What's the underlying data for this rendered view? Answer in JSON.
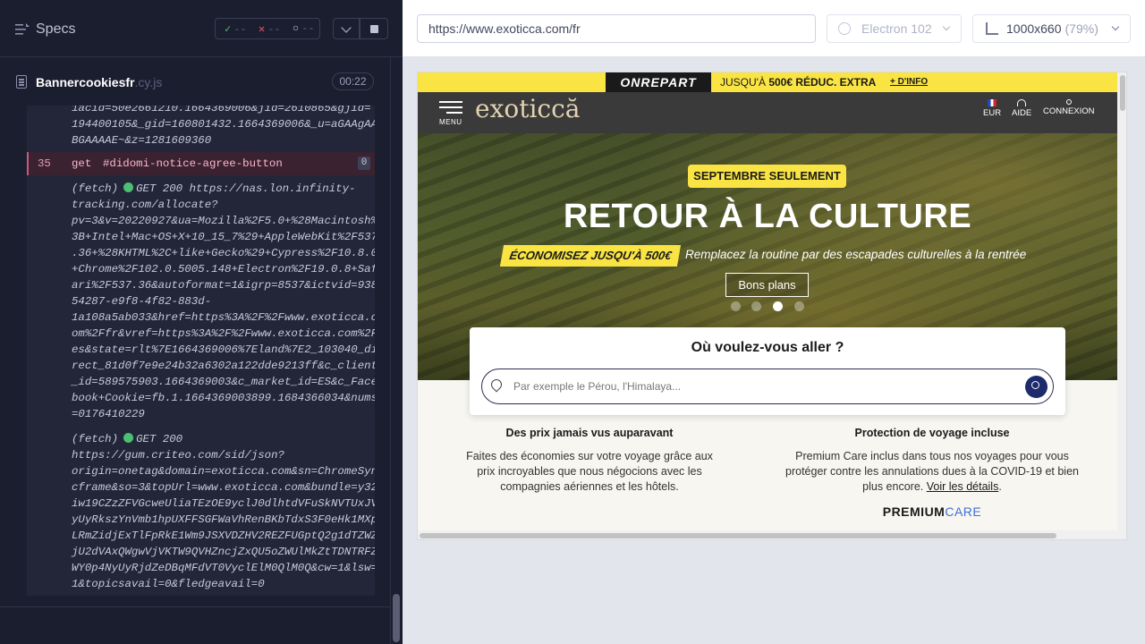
{
  "runner": {
    "specs_title": "Specs",
    "stats": {
      "pass_glyph": "✓",
      "pass_count": "--",
      "fail_glyph": "✕",
      "fail_count": "--",
      "pending_glyph": "○",
      "pending_count": "--"
    },
    "file": {
      "name": "Bannercookiesfr",
      "ext": ".cy.js",
      "time": "00:22"
    },
    "log_top": "1acid=50e2661210.1664369006&jid=2610865&gjid=\n194400105&_gid=160801432.1664369006&_u=aGAAgAA\nBGAAAAE~&z=1281609360",
    "command": {
      "number": "35",
      "name": "get",
      "selector": "#didomi-notice-agree-button",
      "count": "0"
    },
    "fetch1": {
      "prefix": "(fetch)",
      "status": "GET 200",
      "url_first": "https://nas.lon.infinity-",
      "url_rest": "tracking.com/allocate?\npv=3&v=20220927&ua=Mozilla%2F5.0+%28Macintosh%\n3B+Intel+Mac+OS+X+10_15_7%29+AppleWebKit%2F537\n.36+%28KHTML%2C+like+Gecko%29+Cypress%2F10.8.0\n+Chrome%2F102.0.5005.148+Electron%2F19.0.8+Saf\nari%2F537.36&autoformat=1&igrp=8537&ictvid=938\n54287-e9f8-4f82-883d-\n1a108a5ab033&href=https%3A%2F%2Fwww.exoticca.c\nom%2Ffr&vref=https%3A%2F%2Fwww.exoticca.com%2F\nes&state=rlt%7E1664369006%7Eland%7E2_103040_di\nrect_81d0f7e9e24b32a6302a122dde9213ff&c_client\n_id=589575903.1664369003&c_market_id=ES&c_Face\nbook+Cookie=fb.1.1664369003899.1684366034&nums\n=0176410229"
    },
    "fetch2": {
      "prefix": "(fetch)",
      "status": "GET 200",
      "url_rest": "https://gum.criteo.com/sid/json?\norigin=onetag&domain=exoticca.com&sn=ChromeSyn\ncframe&so=3&topUrl=www.exoticca.com&bundle=y32\niw19CZzZFVGcweUliaTEzOE9yclJ0dlhtdVFuSkNVTUxJV\nyUyRkszYnVmb1hpUXFFSGFWaVhRenBKbTdxS3F0eHk1MXp\nLRmZidjExTlFpRkE1Wm9JSXVDZHV2REZFUGptQ2g1dTZWZ\njU2dVAxQWgwVjVKTW9QVHZncjZxQU5oZWUlMkZtTDNTRFZ\nWY0p4NyUyRjdZeDBqMFdVT0VyclElM0QlM0Q&cw=1&lsw=\n1&topicsavail=0&fledgeavail=0"
    }
  },
  "aut_header": {
    "url": "https://www.exoticca.com/fr",
    "browser": "Electron 102",
    "viewport": "1000x660",
    "scale": "(79%)"
  },
  "site": {
    "promo": {
      "brand": "ONREPART",
      "text_prefix": "JUSQU'À ",
      "text_bold": "500€ RÉDUC. EXTRA",
      "link": "+ D'INFO"
    },
    "nav": {
      "menu_label": "MENU",
      "logo": "exoticcă",
      "eur": "EUR",
      "aide": "AIDE",
      "connexion": "CONNEXION"
    },
    "hero": {
      "badge": "SEPTEMBRE SEULEMENT",
      "title": "RETOUR À LA CULTURE",
      "save": "ÉCONOMISEZ JUSQU'À 500€",
      "subtitle": "Remplacez la routine par des escapades culturelles à la rentrée",
      "cta": "Bons plans"
    },
    "search": {
      "title": "Où voulez-vous aller ?",
      "placeholder": "Par exemple le Pérou, l'Himalaya..."
    },
    "features": [
      {
        "title": "Des prix jamais vus auparavant",
        "body": "Faites des économies sur votre voyage grâce aux prix incroyables que nous négocions avec les compagnies aériennes et les hôtels."
      },
      {
        "title": "Protection de voyage incluse",
        "body": "Premium Care inclus dans tous nos voyages pour vous protéger contre les annulations dues à la COVID-19 et bien plus encore. ",
        "link": "Voir les détails",
        "after_link": "."
      }
    ],
    "premium": {
      "part1": "PREMIUM",
      "part2": "CARE"
    }
  }
}
